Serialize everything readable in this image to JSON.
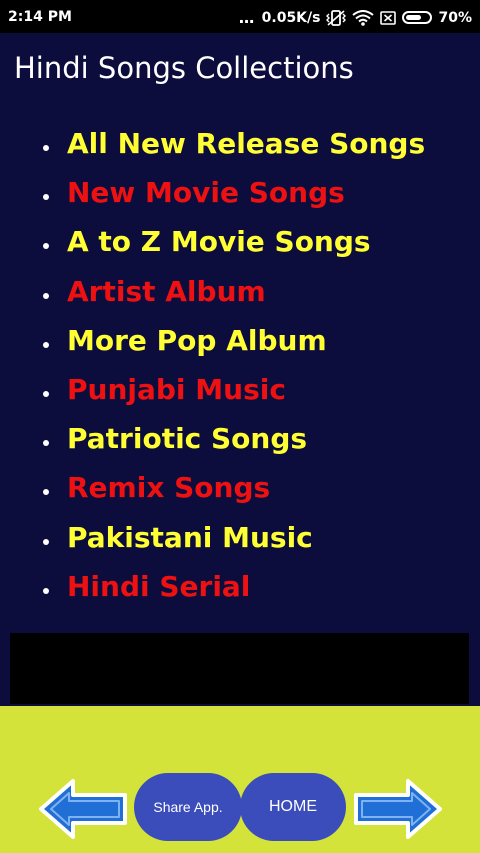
{
  "status_bar": {
    "time": "2:14 PM",
    "dots": "...",
    "network_speed": "0.05K/s",
    "battery_percent": "70%",
    "battery_level": 0.7,
    "icons": [
      "vibrate-icon",
      "wifi-icon",
      "sim-off-icon",
      "battery-icon"
    ]
  },
  "page": {
    "title": "Hindi Songs Collections",
    "background_color": "#0d0d3d"
  },
  "menu": {
    "items": [
      {
        "label": "All New Release Songs",
        "color": "#ffff33"
      },
      {
        "label": "New Movie Songs",
        "color": "#ee1111"
      },
      {
        "label": "A to Z Movie Songs",
        "color": "#ffff33"
      },
      {
        "label": "Artist Album",
        "color": "#ee1111"
      },
      {
        "label": "More Pop Album",
        "color": "#ffff33"
      },
      {
        "label": "Punjabi Music",
        "color": "#ee1111"
      },
      {
        "label": "Patriotic Songs",
        "color": "#ffff33"
      },
      {
        "label": "Remix Songs",
        "color": "#ee1111"
      },
      {
        "label": "Pakistani Music",
        "color": "#ffff33"
      },
      {
        "label": "Hindi Serial",
        "color": "#ee1111"
      }
    ]
  },
  "footer": {
    "background_color": "#d4e33a",
    "share_label": "Share App.",
    "home_label": "HOME",
    "button_color": "#3a4dbb",
    "arrow_color": "#1f6fd6",
    "left_icon": "back-arrow-icon",
    "right_icon": "forward-arrow-icon"
  }
}
